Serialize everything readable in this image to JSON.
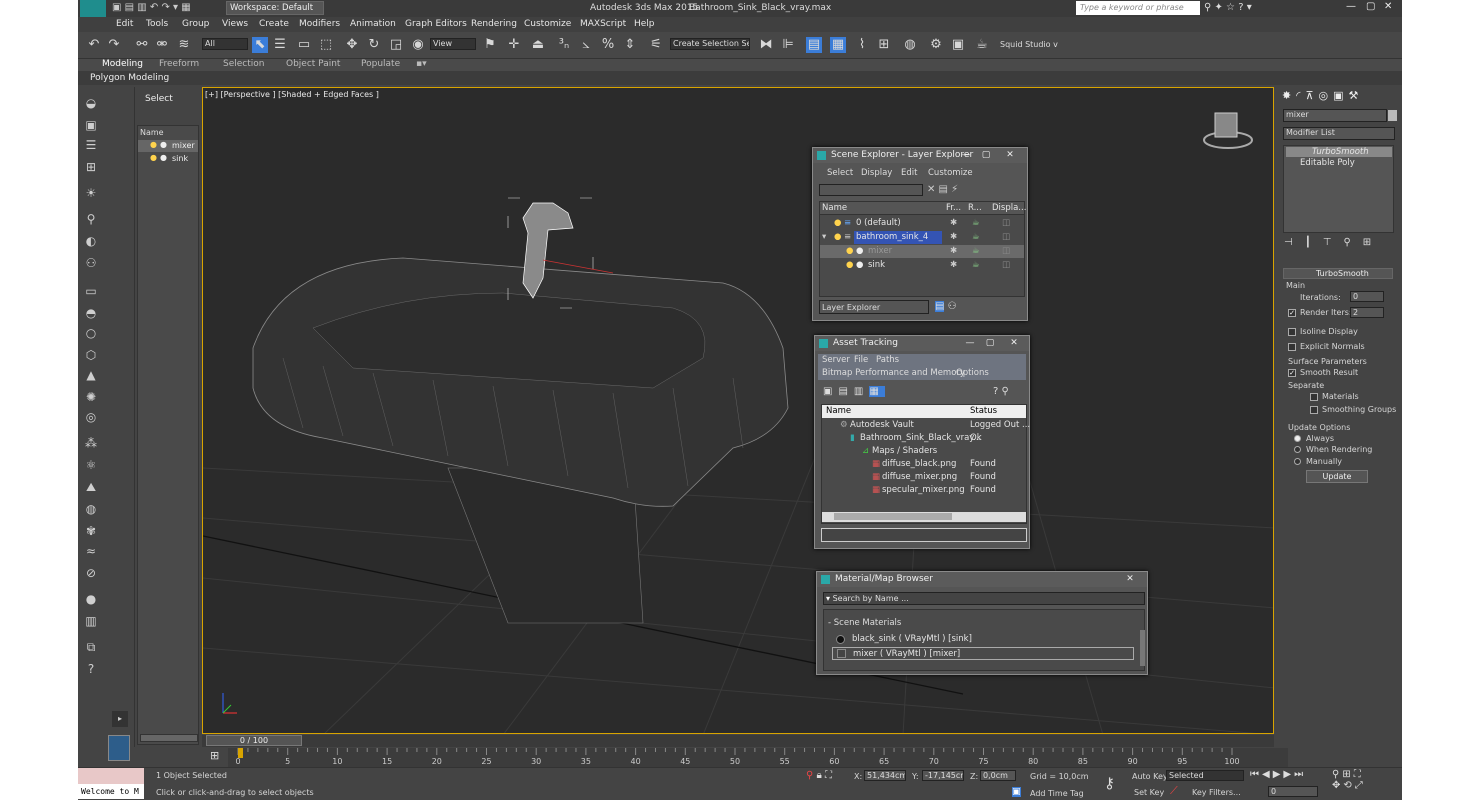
{
  "title": {
    "app": "Autodesk 3ds Max 2015",
    "file": "Bathroom_Sink_Black_vray.max",
    "workspace": "Workspace: Default",
    "search_placeholder": "Type a keyword or phrase"
  },
  "menu": [
    "Edit",
    "Tools",
    "Group",
    "Views",
    "Create",
    "Modifiers",
    "Animation",
    "Graph Editors",
    "Rendering",
    "Customize",
    "MAXScript",
    "Help"
  ],
  "toolbar": {
    "filter": "All",
    "coord": "View",
    "selection_set": "Create Selection Se",
    "squid": "Squid Studio v"
  },
  "ribbon": {
    "tabs": [
      "Modeling",
      "Freeform",
      "Selection",
      "Object Paint",
      "Populate"
    ],
    "sub": "Polygon Modeling"
  },
  "scene_panel": {
    "select": "Select",
    "name_header": "Name",
    "items": [
      "mixer",
      "sink"
    ]
  },
  "viewport": {
    "label": "[+] [Perspective ] [Shaded + Edged Faces ]"
  },
  "scene_explorer": {
    "title": "Scene Explorer - Layer Explorer",
    "menu": [
      "Select",
      "Display",
      "Edit",
      "Customize"
    ],
    "columns": [
      "Name",
      "Fr...",
      "R...",
      "Displa..."
    ],
    "rows": [
      "0 (default)",
      "bathroom_sink_4",
      "mixer",
      "sink"
    ],
    "footer": "Layer Explorer"
  },
  "asset_tracking": {
    "title": "Asset Tracking",
    "menu1": [
      "Server",
      "File",
      "Paths"
    ],
    "menu2": [
      "Bitmap Performance and Memory",
      "Options"
    ],
    "columns": [
      "Name",
      "Status"
    ],
    "rows": [
      {
        "name": "Autodesk Vault",
        "status": "Logged Out ..."
      },
      {
        "name": "Bathroom_Sink_Black_vray...",
        "status": "Ok"
      },
      {
        "name": "Maps / Shaders",
        "status": ""
      },
      {
        "name": "diffuse_black.png",
        "status": "Found"
      },
      {
        "name": "diffuse_mixer.png",
        "status": "Found"
      },
      {
        "name": "specular_mixer.png",
        "status": "Found"
      }
    ]
  },
  "material_browser": {
    "title": "Material/Map Browser",
    "search": "Search by Name ...",
    "section": "- Scene Materials",
    "items": [
      "black_sink  ( VRayMtl )  [sink]",
      "mixer  ( VRayMtl )  [mixer]"
    ]
  },
  "command_panel": {
    "object_name": "mixer",
    "modifier_list": "Modifier List",
    "stack": [
      "TurboSmooth",
      "Editable Poly"
    ],
    "rollout": "TurboSmooth",
    "main": "Main",
    "iterations_label": "Iterations:",
    "iterations": "0",
    "render_iters_label": "Render Iters:",
    "render_iters": "2",
    "isoline": "Isoline Display",
    "explicit": "Explicit Normals",
    "surface": "Surface Parameters",
    "smooth": "Smooth Result",
    "separate": "Separate",
    "materials": "Materials",
    "smoothing_groups": "Smoothing Groups",
    "update_options": "Update Options",
    "always": "Always",
    "when_rendering": "When Rendering",
    "manually": "Manually",
    "update": "Update"
  },
  "timeline": {
    "frame": "0 / 100",
    "ticks": [
      "0",
      "5",
      "10",
      "15",
      "20",
      "25",
      "30",
      "35",
      "40",
      "45",
      "50",
      "55",
      "60",
      "65",
      "70",
      "75",
      "80",
      "85",
      "90",
      "95",
      "100"
    ]
  },
  "status": {
    "welcome": "Welcome to M",
    "selected": "1 Object Selected",
    "hint": "Click or click-and-drag to select objects",
    "x_label": "X:",
    "x": "51,434cm",
    "y_label": "Y:",
    "y": "-17,145cm",
    "z_label": "Z:",
    "z": "0,0cm",
    "grid": "Grid = 10,0cm",
    "auto_key": "Auto Key",
    "set_key": "Set Key",
    "selected_dd": "Selected",
    "add_time_tag": "Add Time Tag",
    "key_filters": "Key Filters...",
    "frame": "0"
  }
}
